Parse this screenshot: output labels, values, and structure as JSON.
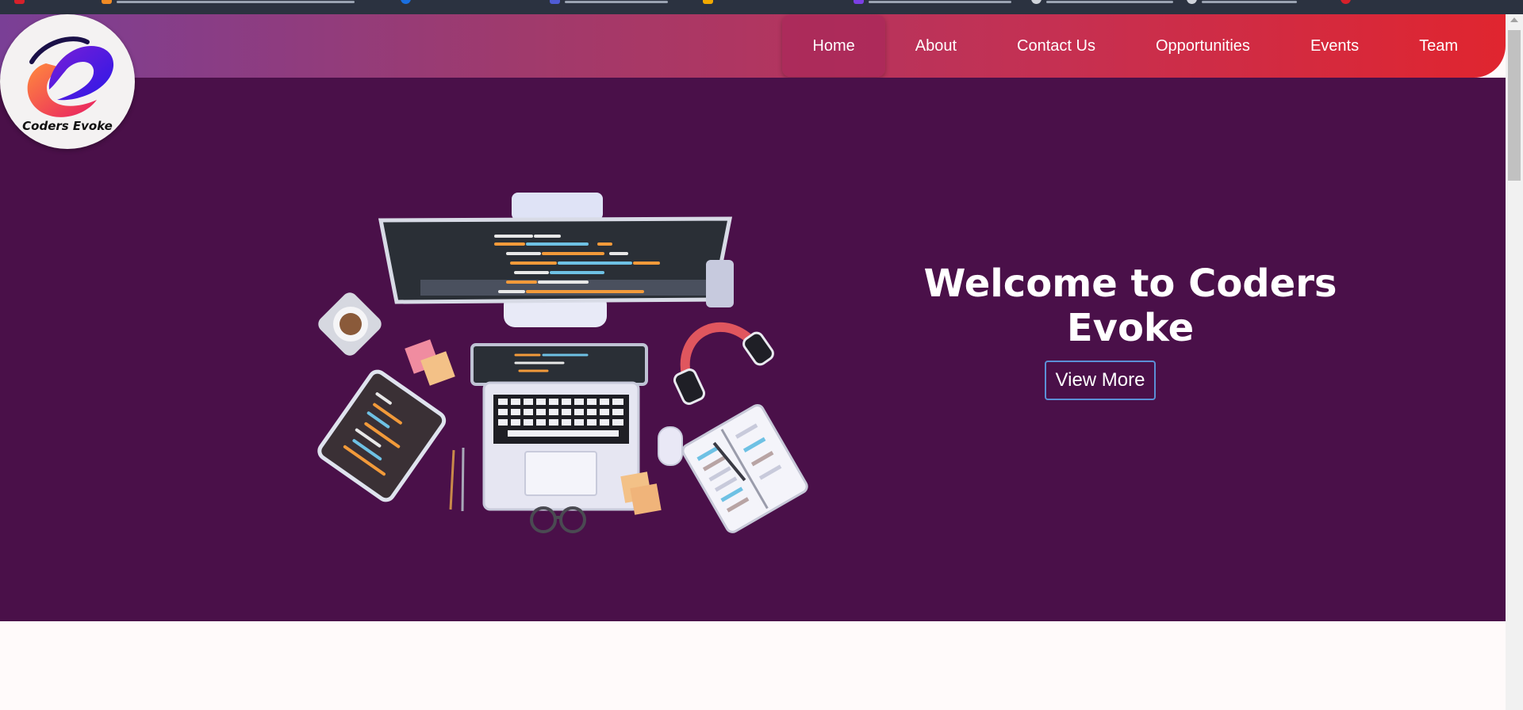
{
  "header": {
    "nav": [
      {
        "label": "Home",
        "active": true
      },
      {
        "label": "About"
      },
      {
        "label": "Contact Us"
      },
      {
        "label": "Opportunities"
      },
      {
        "label": "Events"
      },
      {
        "label": "Team"
      }
    ]
  },
  "logo": {
    "text": "Coders Evoke"
  },
  "hero": {
    "title": "Welcome to Coders Evoke",
    "button_label": "View More"
  },
  "colors": {
    "hero_bg": "#4a1049",
    "header_gradient_start": "#7a3f96",
    "header_gradient_end": "#e0252f",
    "button_border": "#5b8fd6"
  },
  "icons": [
    "logo-icon",
    "workspace-illustration",
    "scroll-up-icon"
  ]
}
